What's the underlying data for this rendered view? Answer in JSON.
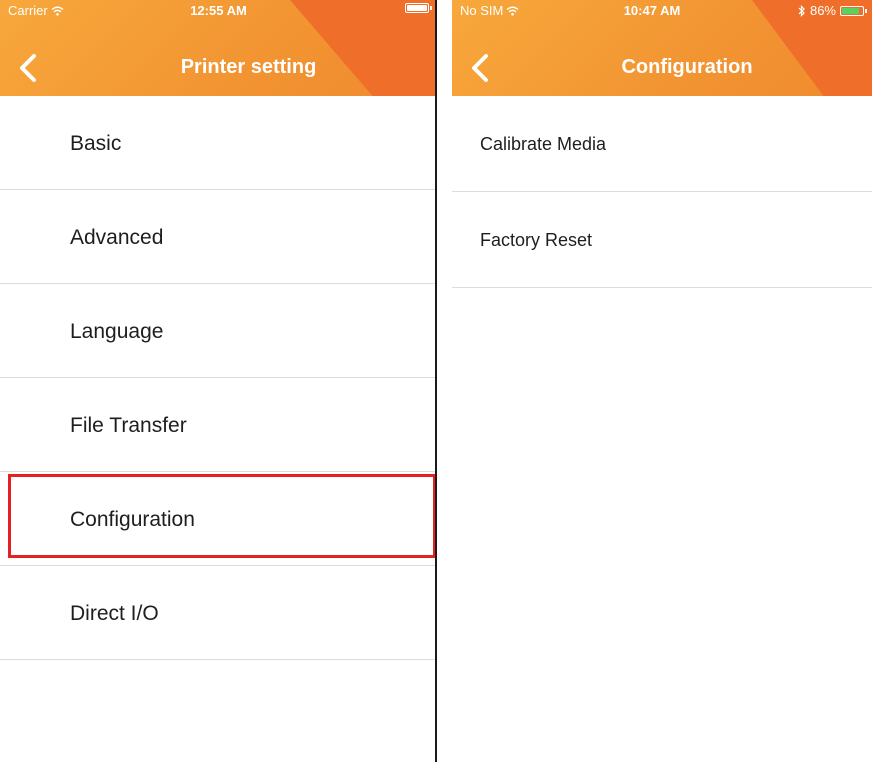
{
  "left_screen": {
    "status": {
      "carrier": "Carrier",
      "time": "12:55 AM"
    },
    "title": "Printer setting",
    "items": [
      {
        "label": "Basic"
      },
      {
        "label": "Advanced"
      },
      {
        "label": "Language"
      },
      {
        "label": "File Transfer"
      },
      {
        "label": "Configuration",
        "highlighted": true
      },
      {
        "label": "Direct I/O"
      }
    ]
  },
  "right_screen": {
    "status": {
      "carrier": "No SIM",
      "time": "10:47 AM",
      "battery": "86%"
    },
    "title": "Configuration",
    "items": [
      {
        "label": "Calibrate Media"
      },
      {
        "label": "Factory Reset"
      }
    ]
  },
  "colors": {
    "header": "#f29432",
    "header_accent": "#ef6f2a",
    "highlight": "#e62020"
  },
  "icons": [
    "back-chevron-icon",
    "wifi-icon",
    "battery-icon",
    "bluetooth-icon"
  ]
}
